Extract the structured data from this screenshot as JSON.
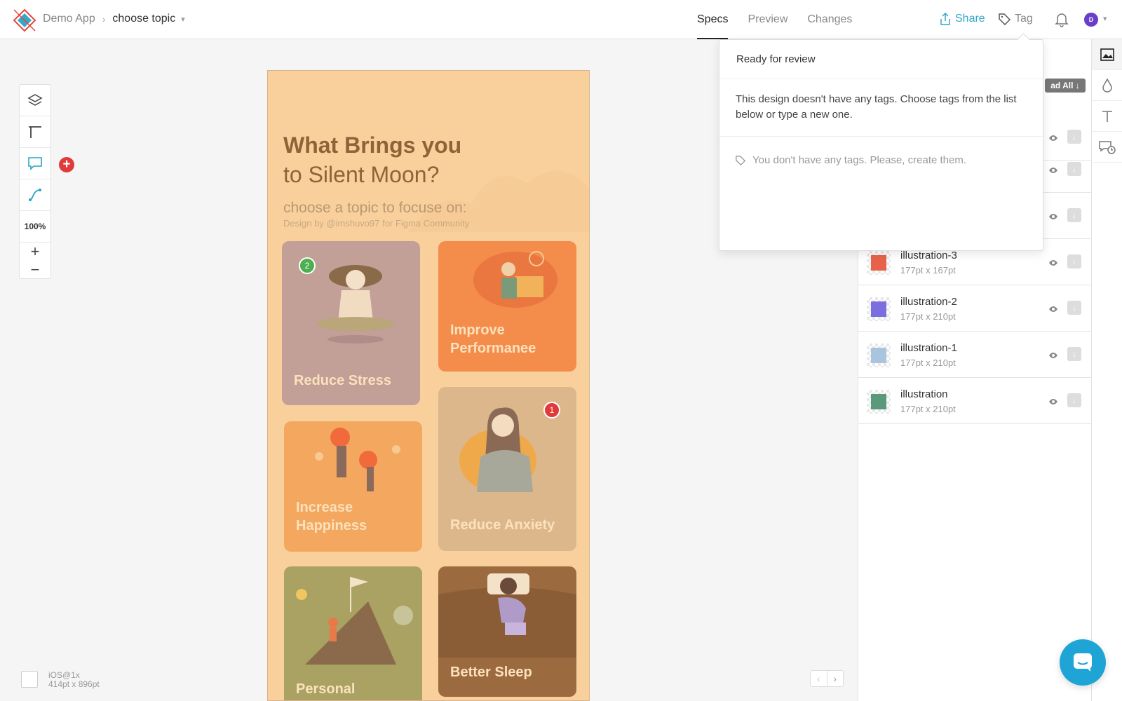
{
  "header": {
    "app_name": "Demo App",
    "page_name": "choose topic",
    "tabs": [
      {
        "label": "Specs",
        "active": true
      },
      {
        "label": "Preview",
        "active": false
      },
      {
        "label": "Changes",
        "active": false
      }
    ],
    "share_label": "Share",
    "tag_label": "Tag",
    "avatar_initial": "D",
    "accent_color": "#34a8c8"
  },
  "toolbar": {
    "zoom_level": "100%",
    "zoom_in": "+",
    "zoom_out": "−"
  },
  "artboard": {
    "title_line1": "What Brings you",
    "title_line2": "to Silent Moon?",
    "subtitle": "choose a topic to focuse on:",
    "credit": "Design by @imshuvo97 for Figma Community",
    "cards": [
      {
        "label": "Reduce Stress",
        "color": "#c29f97"
      },
      {
        "label": "Improve Performanee",
        "color": "#f48d4c"
      },
      {
        "label": "Increase Happiness",
        "color": "#f4a75f"
      },
      {
        "label": "Reduce Anxiety",
        "color": "#dcb78c"
      },
      {
        "label": "Personal",
        "color": "#a9a263"
      },
      {
        "label": "Better Sleep",
        "color": "#9b6a3f"
      }
    ],
    "comment_badges": [
      "2",
      "1"
    ]
  },
  "device": {
    "name": "iOS@1x",
    "dimensions": "414pt x 896pt"
  },
  "assets": {
    "download_all_label": "ad All",
    "items": [
      {
        "name": "illustration-3",
        "size": "177pt x 167pt",
        "color": "#e8624a"
      },
      {
        "name": "illustration-2",
        "size": "177pt x 210pt",
        "color": "#7b6fe0"
      },
      {
        "name": "illustration-1",
        "size": "177pt x 210pt",
        "color": "#a9c4dd"
      },
      {
        "name": "illustration",
        "size": "177pt x 210pt",
        "color": "#5a9a7a"
      }
    ]
  },
  "tag_popover": {
    "input_value": "Ready for review",
    "message": "This design doesn't have any tags. Choose tags from the list below or type a new one.",
    "empty_text": "You don't have any tags. Please, create them."
  }
}
